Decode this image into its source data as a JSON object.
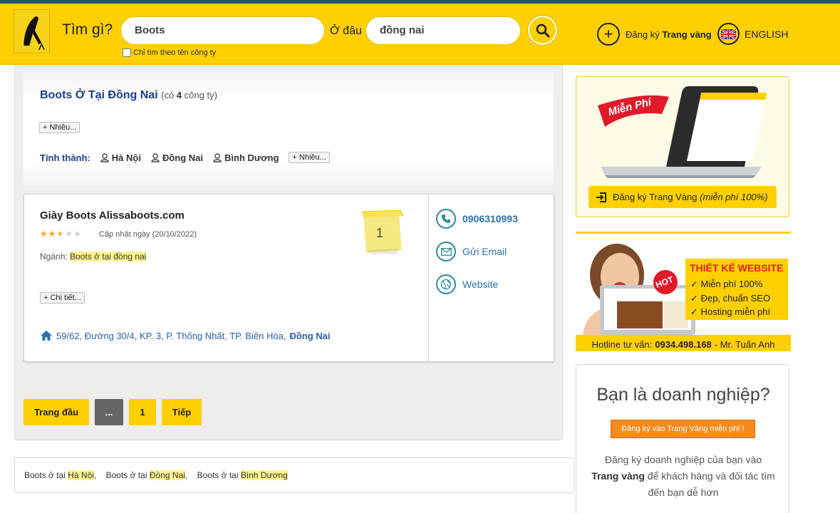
{
  "header": {
    "search_label": "Tìm gì?",
    "search_value": "Boots",
    "where_label": "Ở đâu",
    "where_value": "đồng nai",
    "checkbox_label": "Chỉ tìm theo tên công ty",
    "register_prefix": "Đăng ký",
    "register_bold": "Trang vàng",
    "language": "ENGLISH"
  },
  "filter": {
    "title": "Boots Ở Tại Đồng Nai",
    "count_prefix": "(có",
    "count": "4",
    "count_suffix": "công ty)",
    "more_label": "+ Nhiều...",
    "province_label": "Tỉnh thành:",
    "provinces": [
      "Hà Nội",
      "Đồng Nai",
      "Bình Dương"
    ],
    "province_more": "+ Nhiều..."
  },
  "listing": {
    "name": "Giày Boots Alissaboots.com",
    "rating": 2.5,
    "rating_max": 5,
    "updated": "Cập nhật ngày (20/10/2022)",
    "industry_label": "Ngành:",
    "industry": "Boots ở tại đồng nai",
    "details_label": "+ Chi tiết...",
    "address_text": "59/62, Đường 30/4, KP. 3, P. Thống Nhất, TP. Biên Hòa,",
    "address_province": "Đồng Nai",
    "rank": "1",
    "phone": "0906310993",
    "email_label": "Gửi Email",
    "website_label": "Website"
  },
  "pagination": {
    "first": "Trang đầu",
    "ellipsis": "...",
    "current": "1",
    "next": "Tiếp"
  },
  "related": [
    {
      "prefix": "Boots ở tại",
      "place": "Hà Nội"
    },
    {
      "prefix": "Boots ở tại",
      "place": "Đồng Nai"
    },
    {
      "prefix": "Boots ở tại",
      "place": "Bình Dương"
    }
  ],
  "sidebar": {
    "promo1_ribbon": "Miễn Phí",
    "promo1_button": "Đăng ký Trang Vàng",
    "promo1_button_note": "(miễn phí 100%)",
    "promo2_title": "THIẾT KẾ WEBSITE",
    "promo2_items": [
      "Miễn phí 100%",
      "Đẹp, chuẩn SEO",
      "Hosting miễn phí"
    ],
    "promo2_hot": "HOT",
    "hotline_label": "Hotline tư vấn:",
    "hotline_number": "0934.498.168",
    "hotline_name": "- Mr. Tuấn Anh",
    "biz_heading": "Bạn là doanh nghiệp?",
    "biz_button": "Đăng ký vào Trang Vàng miễn phí !",
    "biz_text_1": "Đăng ký doanh nghiệp của bạn vào",
    "biz_text_bold": "Trang vàng",
    "biz_text_2": "để khách hàng và đối tác tìm đến bạn dễ hơn"
  },
  "colors": {
    "brand_yellow": "#ffd000",
    "link_blue": "#1a3e8c",
    "accent_orange": "#f68b1f"
  }
}
